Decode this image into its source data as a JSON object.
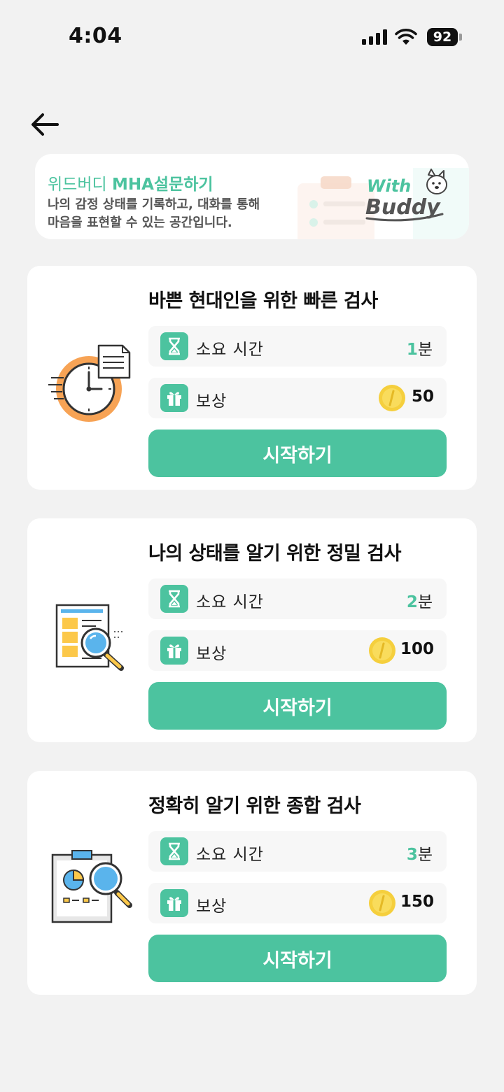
{
  "status_bar": {
    "time": "4:04",
    "battery": "92"
  },
  "banner": {
    "title_prefix": "위드버디",
    "title_bold": "MHA설문하기",
    "desc_line1": "나의 감정 상태를 기록하고, 대화를 통해",
    "desc_line2": "마음을 표현할 수 있는 공간입니다.",
    "logo_line1": "With",
    "logo_line2": "Buddy"
  },
  "colors": {
    "accent": "#4cc39f",
    "background": "#f2f2f2",
    "coin": "#f5cf3d"
  },
  "cards": [
    {
      "title": "바쁜 현대인을 위한 빠른 검사",
      "time_label": "소요 시간",
      "time_value": "1",
      "time_unit": "분",
      "reward_label": "보상",
      "reward_value": "50",
      "button": "시작하기",
      "illustration": "clock-document-icon"
    },
    {
      "title": "나의 상태를 알기 위한 정밀 검사",
      "time_label": "소요 시간",
      "time_value": "2",
      "time_unit": "분",
      "reward_label": "보상",
      "reward_value": "100",
      "button": "시작하기",
      "illustration": "report-magnifier-icon"
    },
    {
      "title": "정확히 알기 위한 종합 검사",
      "time_label": "소요 시간",
      "time_value": "3",
      "time_unit": "분",
      "reward_label": "보상",
      "reward_value": "150",
      "button": "시작하기",
      "illustration": "clipboard-chart-magnifier-icon"
    }
  ]
}
